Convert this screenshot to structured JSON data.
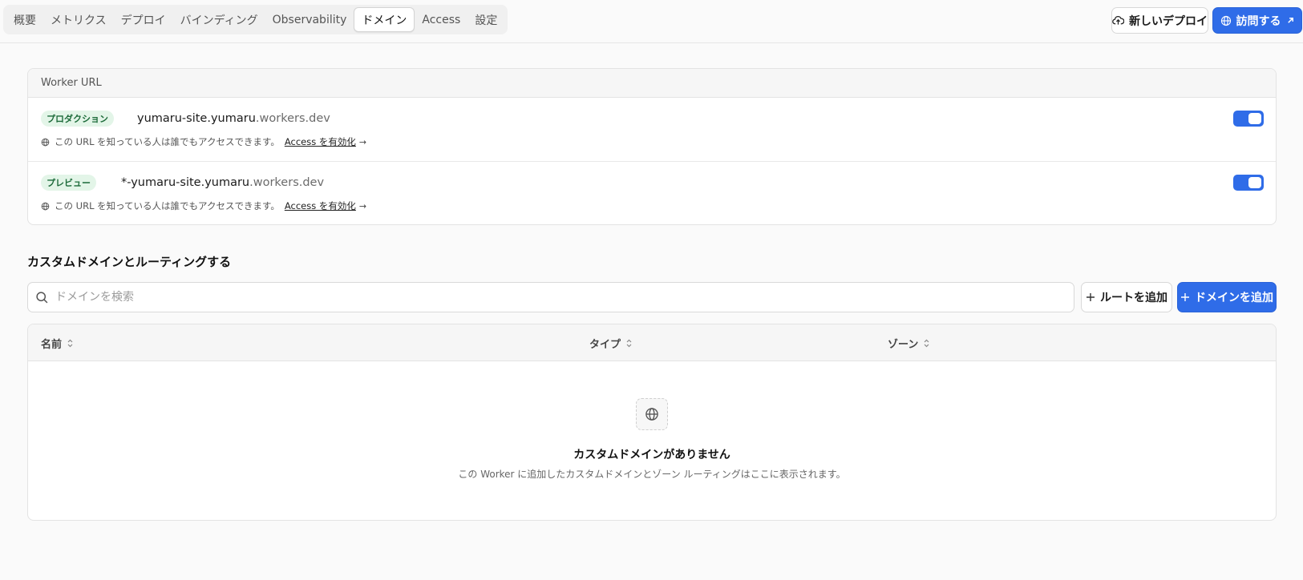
{
  "tabs": [
    {
      "label": "概要",
      "active": false
    },
    {
      "label": "メトリクス",
      "active": false
    },
    {
      "label": "デプロイ",
      "active": false
    },
    {
      "label": "バインディング",
      "active": false
    },
    {
      "label": "Observability",
      "active": false
    },
    {
      "label": "ドメイン",
      "active": true
    },
    {
      "label": "Access",
      "active": false
    },
    {
      "label": "設定",
      "active": false
    }
  ],
  "header": {
    "new_deploy_label": "新しいデプロイ",
    "new_deploy_icon": "cloud-upload-icon",
    "visit_label": "訪問する",
    "visit_icon": "globe-icon"
  },
  "worker_url": {
    "title": "Worker URL",
    "rows": [
      {
        "badge": "プロダクション",
        "host": "yumaru-site.yumaru",
        "suffix": ".workers.dev",
        "note": "この URL を知っている人は誰でもアクセスできます。",
        "link": "Access を有効化",
        "enabled": true
      },
      {
        "badge": "プレビュー",
        "host": "*-yumaru-site.yumaru",
        "suffix": ".workers.dev",
        "note": "この URL を知っている人は誰でもアクセスできます。",
        "link": "Access を有効化",
        "enabled": true
      }
    ]
  },
  "custom_domains": {
    "title": "カスタムドメインとルーティングする",
    "search_placeholder": "ドメインを検索",
    "add_route_label": "ルートを追加",
    "add_domain_label": "ドメインを追加",
    "columns": [
      "名前",
      "タイプ",
      "ゾーン"
    ],
    "empty_title": "カスタムドメインがありません",
    "empty_desc": "この Worker に追加したカスタムドメインとゾーン ルーティングはここに表示されます。"
  },
  "colors": {
    "accent": "#2f6ce8",
    "badge_bg": "#e3f5e8",
    "badge_text": "#1d6b3a"
  }
}
